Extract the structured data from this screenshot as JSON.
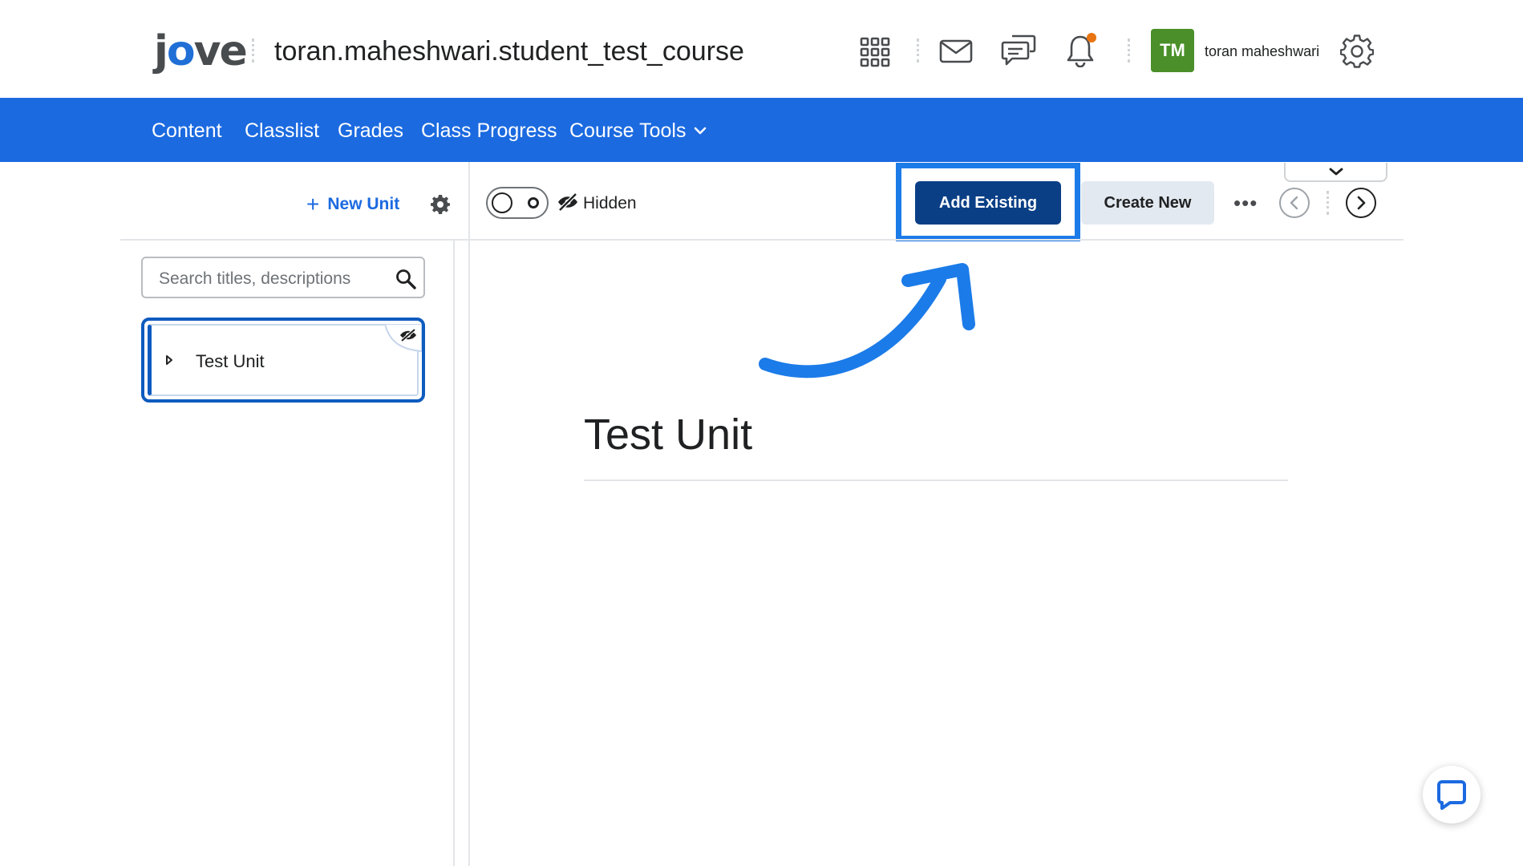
{
  "header": {
    "logo_text_prefix": "j",
    "logo_text_o": "o",
    "logo_text_suffix": "ve",
    "course_title": "toran.maheshwari.student_test_course",
    "avatar_initials": "TM",
    "user_name": "toran maheshwari",
    "icons": [
      "waffle-grid-icon",
      "mail-icon",
      "discussions-icon",
      "bell-icon",
      "gear-icon"
    ]
  },
  "nav": {
    "items": [
      "Content",
      "Classlist",
      "Grades",
      "Class Progress"
    ],
    "course_tools": "Course Tools"
  },
  "sidebar": {
    "new_unit_plus": "+",
    "new_unit_label": "New Unit",
    "search_placeholder": "Search titles, descriptions",
    "search_value": "",
    "units": [
      {
        "title": "Test Unit",
        "hidden": true
      }
    ]
  },
  "toolbar": {
    "visibility_label": "Hidden",
    "add_existing_label": "Add Existing",
    "create_new_label": "Create New",
    "more_label": "•••"
  },
  "main": {
    "unit_title": "Test Unit"
  },
  "colors": {
    "nav_blue": "#1b6ae0",
    "primary_button": "#0a3f86",
    "highlight": "#1b7be8",
    "avatar_green": "#4a8f29",
    "notification_orange": "#e87511"
  }
}
